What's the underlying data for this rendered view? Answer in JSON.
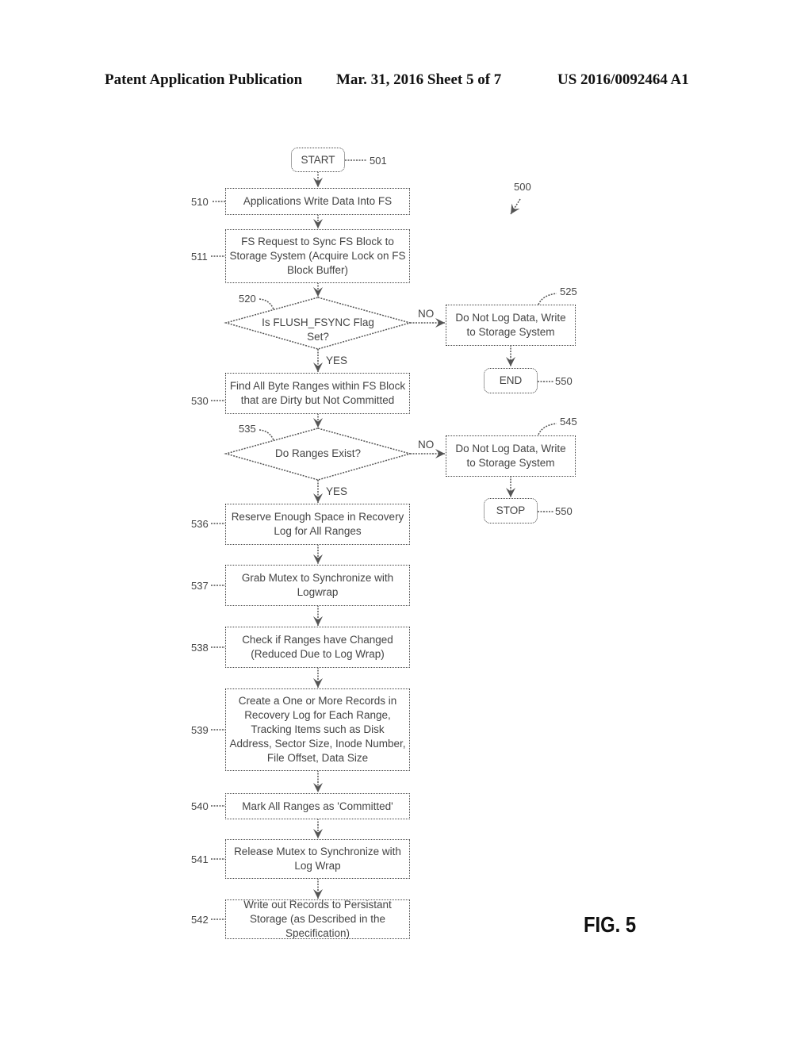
{
  "header": {
    "publication": "Patent Application Publication",
    "date_sheet": "Mar. 31, 2016  Sheet 5 of 7",
    "pub_number": "US 2016/0092464 A1"
  },
  "figure": {
    "label": "FIG. 5",
    "ref": "500"
  },
  "nodes": {
    "start": {
      "ref": "501",
      "text": "START"
    },
    "n510": {
      "ref": "510",
      "text": "Applications Write Data Into FS"
    },
    "n511": {
      "ref": "511",
      "text": "FS Request to Sync FS Block to Storage System (Acquire Lock on FS Block Buffer)"
    },
    "n520": {
      "ref": "520",
      "line1": "Is FLUSH_FSYNC Flag",
      "line2": "Set?"
    },
    "n525": {
      "ref": "525",
      "text": "Do Not Log Data, Write to Storage System"
    },
    "end1": {
      "ref": "550",
      "text": "END"
    },
    "n530": {
      "ref": "530",
      "text": "Find All Byte Ranges within FS Block that are Dirty but Not Committed"
    },
    "n535": {
      "ref": "535",
      "line1": "Do Ranges Exist?"
    },
    "n545": {
      "ref": "545",
      "text": "Do Not Log Data, Write to Storage System"
    },
    "end2": {
      "ref": "550",
      "text": "STOP"
    },
    "n536": {
      "ref": "536",
      "text": "Reserve Enough Space in Recovery Log for All Ranges"
    },
    "n537": {
      "ref": "537",
      "text": "Grab Mutex to Synchronize with Logwrap"
    },
    "n538": {
      "ref": "538",
      "text": "Check if Ranges have Changed (Reduced Due to Log Wrap)"
    },
    "n539": {
      "ref": "539",
      "text": "Create a One or More Records in Recovery Log for Each Range, Tracking Items such as Disk Address, Sector Size, Inode Number, File Offset, Data Size"
    },
    "n540": {
      "ref": "540",
      "text": "Mark All Ranges as 'Committed'"
    },
    "n541": {
      "ref": "541",
      "text": "Release Mutex to Synchronize with Log Wrap"
    },
    "n542": {
      "ref": "542",
      "text": "Write out Records to Persistant Storage (as Described in the Specification)"
    }
  },
  "edge_labels": {
    "yes": "YES",
    "no": "NO"
  }
}
